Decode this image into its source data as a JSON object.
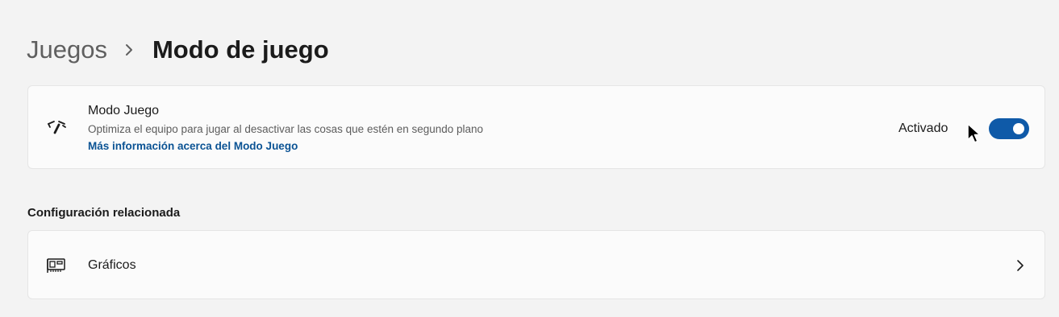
{
  "breadcrumb": {
    "parent": "Juegos",
    "separator_icon": "chevron-right-icon",
    "current": "Modo de juego"
  },
  "game_mode": {
    "icon": "speedometer-icon",
    "title": "Modo Juego",
    "description": "Optimiza el equipo para jugar al desactivar las cosas que estén en segundo plano",
    "link": "Más información acerca del Modo Juego",
    "state_label": "Activado",
    "toggle_on": true,
    "accent_color": "#0f5aa8"
  },
  "related": {
    "heading": "Configuración relacionada",
    "items": [
      {
        "icon": "graphics-card-icon",
        "label": "Gráficos",
        "chevron": "chevron-right-icon"
      }
    ]
  }
}
